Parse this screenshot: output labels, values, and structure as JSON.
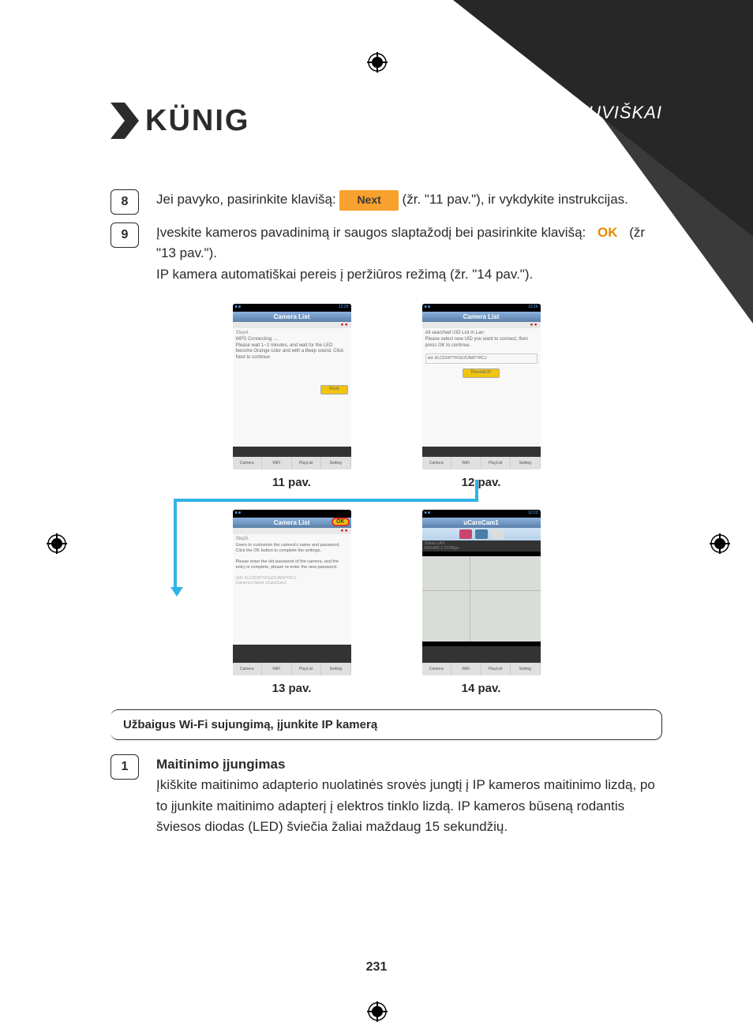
{
  "header": {
    "brand": "KÜNIG",
    "language_label": "LIETUVIŠKAI"
  },
  "steps": {
    "s8": {
      "num": "8",
      "text_a": "Jei pavyko, pasirinkite klavišą: ",
      "btn": "Next",
      "text_b": " (žr. \"11 pav.\"), ir vykdykite instrukcijas."
    },
    "s9": {
      "num": "9",
      "line1_a": "Įveskite kameros pavadinimą ir saugos slaptažodį bei pasirinkite klavišą: ",
      "ok": "OK",
      "line1_b": " (žr \"13 pav.\").",
      "line2": "IP kamera automatiškai pereis į peržiūros režimą (žr. \"14 pav.\")."
    }
  },
  "figures": {
    "f11": {
      "caption": "11 pav.",
      "time": "12:25",
      "header": "Camera List",
      "step": "Step4.",
      "body": "WPS Connecting ....\nPlease wait 1~2 minutes, and wait for the LED become Orange color and with a Beep sound, Click Next to continue",
      "btn": "Next",
      "tabs": [
        "Camera",
        "WiFi",
        "PlayList",
        "Setting"
      ]
    },
    "f12": {
      "caption": "12 pav.",
      "time": "12:26",
      "header": "Camera List",
      "body": "All searched UID List in Lan:\nPlease select new UID you want to connect, then press OK to continue.",
      "uid": "uid: ELC91W7YKSU2UN6PYRCJ",
      "btn": "Research",
      "tabs": [
        "Camera",
        "WiFi",
        "PlayList",
        "Setting"
      ]
    },
    "f13": {
      "caption": "13 pav.",
      "header": "Camera List",
      "ok": "OK",
      "step": "Step5.",
      "body": "Users to customize the camera's name and password, Click the OK button to complete the settings.\n\nPlease enter the old password of the camera, and the entry is complete, please re-enter the new password.",
      "uid_label": "UID:",
      "uid_val": "ELC91W7YKSU2UN6PYRCJ",
      "name_label": "Camera's Name",
      "name_val": "uCareCam2",
      "tabs": [
        "Camera",
        "WiFi",
        "PlayList",
        "Setting"
      ]
    },
    "f14": {
      "caption": "14 pav.",
      "time": "12:23",
      "header": "uCareCam1",
      "status": "Online   LAN",
      "res": "640x480   2   15760ps",
      "tabs": [
        "Camera",
        "WiFi",
        "PlayList",
        "Setting"
      ]
    }
  },
  "callout": "Užbaigus Wi-Fi sujungimą, įjunkite IP kamerą",
  "section1": {
    "num": "1",
    "title": "Maitinimo įjungimas",
    "body": "Įkiškite maitinimo adapterio nuolatinės srovės jungtį į IP kameros maitinimo lizdą, po to įjunkite maitinimo adapterį į elektros tinklo lizdą. IP kameros būseną rodantis šviesos diodas (LED) šviečia žaliai maždaug 15 sekundžių."
  },
  "page_number": "231"
}
